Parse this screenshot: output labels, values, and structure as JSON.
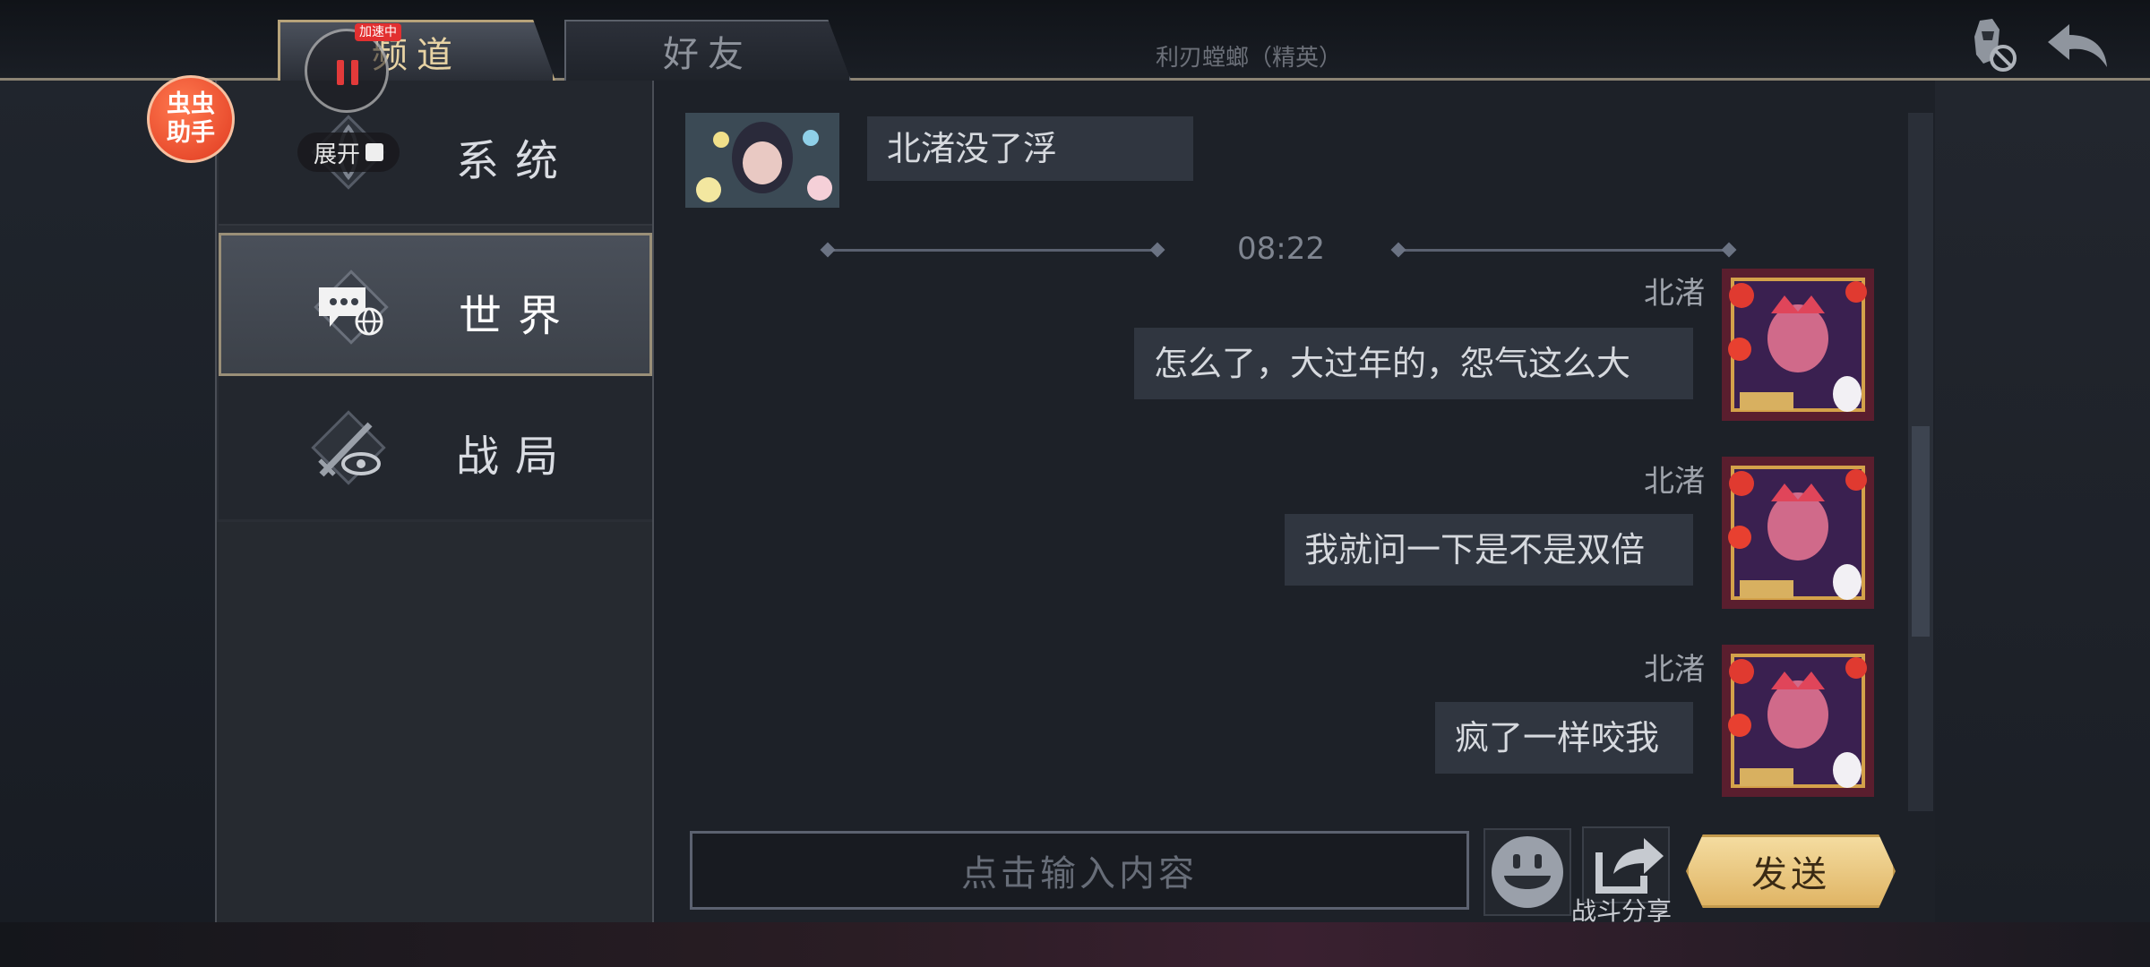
{
  "topbar": {
    "tabs": [
      {
        "label": "频道",
        "active": true
      },
      {
        "label": "好友",
        "active": false
      }
    ],
    "enemy_name": "利刃螳螂（精英）",
    "icons": [
      "helmet-block-icon",
      "back-arrow-icon"
    ]
  },
  "overlay": {
    "bug_assistant": "虫虫助手",
    "accel_badge": "加速中",
    "expand_label": "展开"
  },
  "sidebar": {
    "items": [
      {
        "label": "系统",
        "icon": "system-emblem-icon"
      },
      {
        "label": "世界",
        "icon": "world-chat-icon",
        "selected": true
      },
      {
        "label": "战局",
        "icon": "battle-sword-eye-icon"
      }
    ]
  },
  "chat": {
    "messages": [
      {
        "sender": "",
        "text": "北渚没了浮",
        "side": "left"
      },
      {
        "sender": "北渚",
        "text": "怎么了，大过年的，怨气这么大",
        "side": "right"
      },
      {
        "sender": "北渚",
        "text": "我就问一下是不是双倍",
        "side": "right"
      },
      {
        "sender": "北渚",
        "text": "疯了一样咬我",
        "side": "right"
      }
    ],
    "time_divider": "08:22"
  },
  "input": {
    "placeholder": "点击输入内容",
    "share_label": "战斗分享",
    "send_label": "发送"
  },
  "colors": {
    "accent_gold": "#e0b565",
    "panel": "#2a2e35",
    "bubble": "#303640"
  }
}
